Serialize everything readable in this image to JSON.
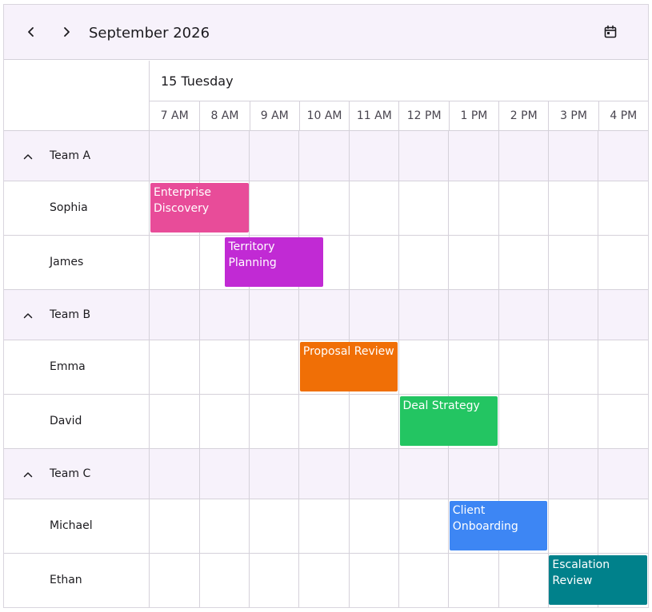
{
  "toolbar": {
    "month_title": "September 2026",
    "prev_icon": "chevron-left-icon",
    "next_icon": "chevron-right-icon",
    "calendar_icon": "calendar-icon"
  },
  "day_header": {
    "label": "15 Tuesday"
  },
  "time_slots": [
    "7 AM",
    "8 AM",
    "9 AM",
    "10 AM",
    "11 AM",
    "12 PM",
    "1 PM",
    "2 PM",
    "3 PM",
    "4 PM"
  ],
  "rows": [
    {
      "type": "group",
      "label": "Team A"
    },
    {
      "type": "person",
      "label": "Sophia"
    },
    {
      "type": "person",
      "label": "James"
    },
    {
      "type": "group",
      "label": "Team B"
    },
    {
      "type": "person",
      "label": "Emma"
    },
    {
      "type": "person",
      "label": "David"
    },
    {
      "type": "group",
      "label": "Team C"
    },
    {
      "type": "person",
      "label": "Michael"
    },
    {
      "type": "person",
      "label": "Ethan"
    }
  ],
  "appointments": [
    {
      "row": 1,
      "start": 7.0,
      "end": 9.0,
      "title": "Enterprise Discovery",
      "color": "#e84c99"
    },
    {
      "row": 2,
      "start": 8.5,
      "end": 10.5,
      "title": "Territory Planning",
      "color": "#c12ad4"
    },
    {
      "row": 4,
      "start": 10.0,
      "end": 12.0,
      "title": "Proposal Review",
      "color": "#f06f06"
    },
    {
      "row": 5,
      "start": 12.0,
      "end": 14.0,
      "title": "Deal Strategy",
      "color": "#23c562"
    },
    {
      "row": 7,
      "start": 13.0,
      "end": 15.0,
      "title": "Client Onboarding",
      "color": "#3d86f4"
    },
    {
      "row": 8,
      "start": 15.0,
      "end": 17.0,
      "title": "Escalation Review",
      "color": "#00818b"
    }
  ]
}
